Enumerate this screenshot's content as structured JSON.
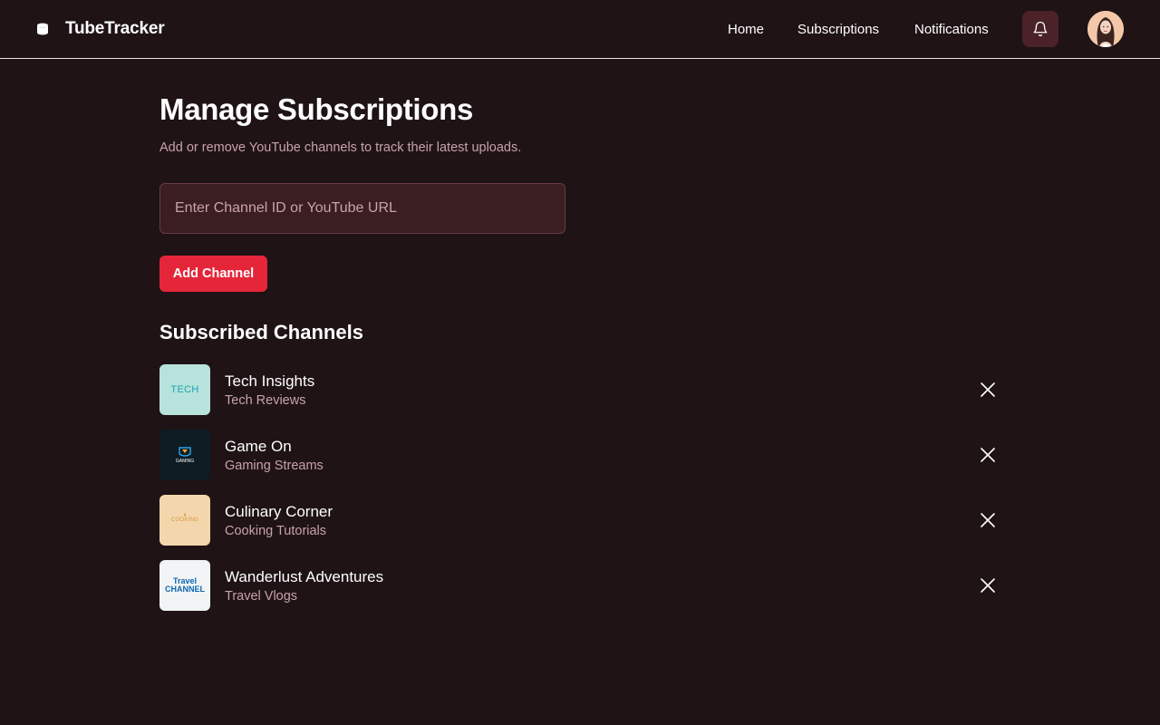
{
  "header": {
    "app_name": "TubeTracker",
    "nav": [
      "Home",
      "Subscriptions",
      "Notifications"
    ],
    "icons": {
      "logo": "database-icon",
      "notifications": "bell-icon"
    }
  },
  "main": {
    "title": "Manage Subscriptions",
    "subtitle": "Add or remove YouTube channels to track their latest uploads.",
    "input": {
      "placeholder": "Enter Channel ID or YouTube URL",
      "value": ""
    },
    "add_button_label": "Add Channel",
    "section_title": "Subscribed Channels",
    "channels": [
      {
        "name": "Tech Insights",
        "category": "Tech Reviews",
        "thumb_label": "TECH",
        "thumb_bg": "#b7e3dc",
        "thumb_fg": "#1aa6b0"
      },
      {
        "name": "Game On",
        "category": "Gaming Streams",
        "thumb_label": "GAMING",
        "thumb_bg": "#0e1c24",
        "thumb_fg": "#ffffff"
      },
      {
        "name": "Culinary Corner",
        "category": "Cooking Tutorials",
        "thumb_label": "COOKING",
        "thumb_bg": "#f3d6ac",
        "thumb_fg": "#d99a3c"
      },
      {
        "name": "Wanderlust Adventures",
        "category": "Travel Vlogs",
        "thumb_label": "Travel CHANNEL",
        "thumb_bg": "#f2f3f4",
        "thumb_fg": "#0b67b2"
      }
    ]
  },
  "colors": {
    "background": "#1f1315",
    "accent": "#e5263a",
    "muted_text": "#c9a3a8",
    "input_bg": "#3a1e22"
  }
}
